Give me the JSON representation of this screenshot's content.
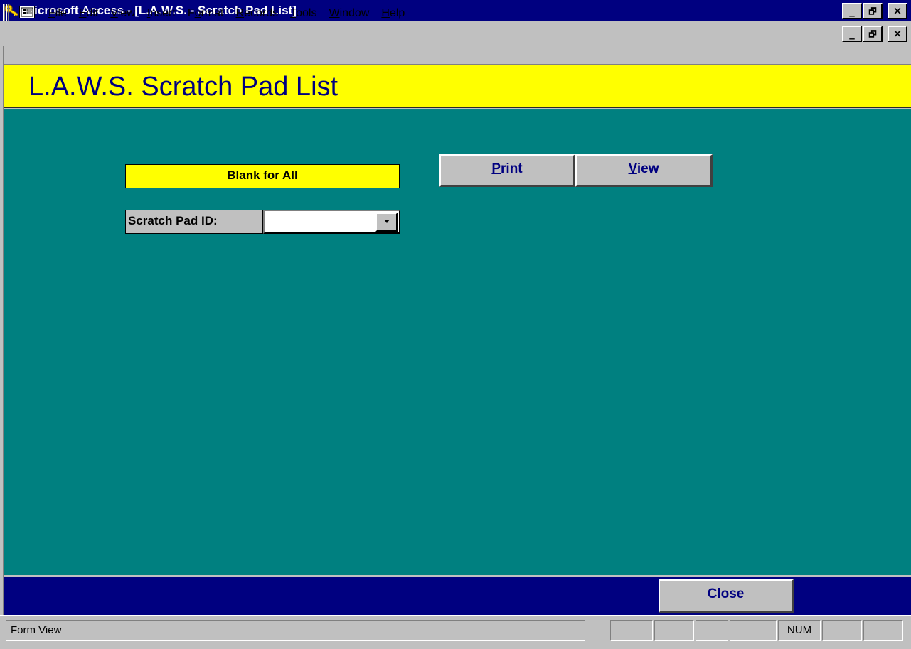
{
  "window": {
    "title": "Microsoft Access - [L.A.W.S. - Scratch Pad List]",
    "icon": "key-icon",
    "controls": {
      "minimize": "_",
      "restore": "🗗",
      "close": "×"
    }
  },
  "menubar": {
    "form_icon": "form-view-icon",
    "items": [
      {
        "label": "File",
        "underline": "F",
        "rest": "ile"
      },
      {
        "label": "Edit",
        "underline": "E",
        "rest": "dit"
      },
      {
        "label": "View",
        "underline": "V",
        "rest": "iew"
      },
      {
        "label": "Insert",
        "underline": "I",
        "rest": "nsert"
      },
      {
        "label": "Format",
        "pre": "F",
        "underline": "o",
        "rest": "rmat"
      },
      {
        "label": "Records",
        "underline": "R",
        "rest": "ecords"
      },
      {
        "label": "Tools",
        "underline": "T",
        "rest": "ools"
      },
      {
        "label": "Window",
        "underline": "W",
        "rest": "indow"
      },
      {
        "label": "Help",
        "underline": "H",
        "rest": "elp"
      }
    ],
    "controls": {
      "minimize": "_",
      "restore": "🗗",
      "close": "×"
    }
  },
  "form": {
    "title": "L.A.W.S. Scratch Pad List",
    "blank_label": "Blank for All",
    "id_label": "Scratch Pad ID:",
    "id_value": "",
    "print_button": {
      "underline": "P",
      "rest": "rint"
    },
    "view_button": {
      "underline": "V",
      "rest": "iew"
    },
    "close_button": {
      "underline": "C",
      "rest": "lose"
    }
  },
  "statusbar": {
    "text": "Form View",
    "indicators": [
      "",
      "",
      "",
      "",
      "NUM",
      "",
      ""
    ]
  },
  "colors": {
    "titlebar": "#000080",
    "header": "#ffff00",
    "detail": "#008080",
    "footer": "#000080",
    "title_text": "#000080"
  }
}
